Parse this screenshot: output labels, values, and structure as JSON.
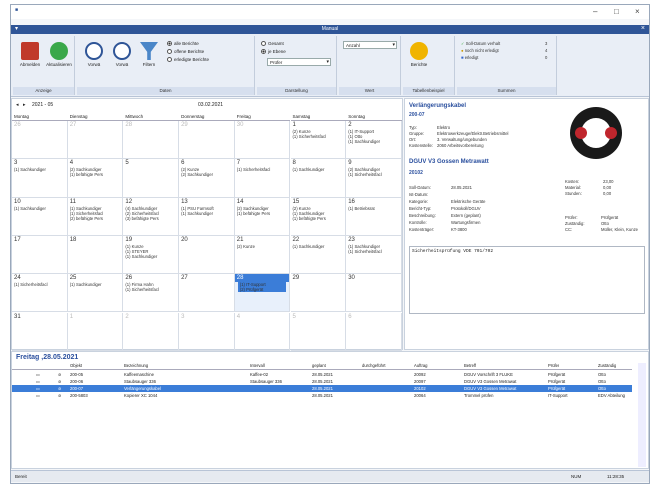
{
  "window": {
    "title": "Manual",
    "min": "–",
    "max": "□",
    "close": "×"
  },
  "ribbon": {
    "groups": [
      {
        "label": "Anzeige"
      },
      {
        "label": "Daten"
      },
      {
        "label": "Darstellung"
      },
      {
        "label": "Wert"
      },
      {
        "label": "Tabellenbeispiel"
      },
      {
        "label": "Summen"
      }
    ],
    "buttons": {
      "abmelden": "Abmelden",
      "aktualisieren": "Aktualisieren",
      "vorwaerts": "Vorwä",
      "rueckwaerts": "Vorwä",
      "filtern": "Filtern",
      "berichte": "Berichte"
    },
    "radios_daten": [
      "alle Berichte",
      "offene Berichte",
      "erledigte Berichte"
    ],
    "radios_darst": [
      "Gesamt",
      "je Ebene"
    ],
    "combo_pruefer": "Prüfer",
    "combo_wert": "Anzahl",
    "summen": [
      {
        "label": "Soll-Datum verhalt",
        "value": "3"
      },
      {
        "label": "noch nicht erledigt",
        "value": "4"
      },
      {
        "label": "erledigt",
        "value": "0"
      }
    ]
  },
  "calendar": {
    "month": "2021 - 05",
    "date_center": "03.02.2021",
    "weekdays": [
      "Montag",
      "Dienstag",
      "Mittwoch",
      "Donnerstag",
      "Freitag",
      "Samstag",
      "Sonntag"
    ],
    "weeks": [
      [
        {
          "d": "26",
          "dim": true,
          "ev": []
        },
        {
          "d": "27",
          "dim": true,
          "ev": []
        },
        {
          "d": "28",
          "dim": true,
          "ev": []
        },
        {
          "d": "29",
          "dim": true,
          "ev": []
        },
        {
          "d": "30",
          "dim": true,
          "ev": []
        },
        {
          "d": "1",
          "ev": [
            "(2) Kunze",
            "(1) Sicherheitsfacl"
          ]
        },
        {
          "d": "2",
          "ev": [
            "(1) IT-Support",
            "(1) Otto",
            "(1) Sachkundiger"
          ]
        }
      ],
      [
        {
          "d": "3",
          "ev": [
            "(1) Sachkundiger"
          ]
        },
        {
          "d": "4",
          "ev": [
            "(2) Sachkundiger",
            "(1) befähigte Pers"
          ]
        },
        {
          "d": "5",
          "ev": []
        },
        {
          "d": "6",
          "ev": [
            "(2) Kunze",
            "(2) Sachkundiger"
          ]
        },
        {
          "d": "7",
          "ev": [
            "(1) Sicherheitsfacl"
          ]
        },
        {
          "d": "8",
          "ev": [
            "(1) Sachkundiger"
          ]
        },
        {
          "d": "9",
          "ev": [
            "(2) Sachkundiger",
            "(1) Sicherheitsfacl"
          ]
        }
      ],
      [
        {
          "d": "10",
          "ev": [
            "(1) Sachkundiger"
          ]
        },
        {
          "d": "11",
          "ev": [
            "(1) Sachkundiger",
            "(1) Sicherheitsfacl",
            "(2) befähigte Pers"
          ]
        },
        {
          "d": "12",
          "ev": [
            "(4) Sachkundiger",
            "(2) Sicherheitsfacl",
            "(3) befähigte Pers"
          ]
        },
        {
          "d": "13",
          "ev": [
            "(1) PSU Farmsoft",
            "(1) Sachkundiger"
          ]
        },
        {
          "d": "14",
          "ev": [
            "(2) Sachkundiger",
            "(1) befähigte Pers"
          ]
        },
        {
          "d": "15",
          "ev": [
            "(2) Kunze",
            "(1) Sachkundiger",
            "(1) befähigte Pers"
          ]
        },
        {
          "d": "16",
          "ev": [
            "(1) Betriebsrat"
          ]
        }
      ],
      [
        {
          "d": "17",
          "ev": []
        },
        {
          "d": "18",
          "ev": []
        },
        {
          "d": "19",
          "ev": [
            "(1) Kunze",
            "(1) STEYER",
            "(1) Sachkundiger"
          ]
        },
        {
          "d": "20",
          "ev": []
        },
        {
          "d": "21",
          "ev": [
            "(2) Kunze"
          ]
        },
        {
          "d": "22",
          "ev": [
            "(1) Sachkundiger"
          ]
        },
        {
          "d": "23",
          "ev": [
            "(1) Sachkundiger",
            "(1) Sicherheitsfacl"
          ]
        }
      ],
      [
        {
          "d": "24",
          "ev": [
            "(1) Sicherheitsfacl"
          ]
        },
        {
          "d": "25",
          "ev": [
            "(1) Sachkundiger"
          ]
        },
        {
          "d": "26",
          "ev": [
            "(1) Firma Hahn",
            "(1) Sicherheitsfacl"
          ]
        },
        {
          "d": "27",
          "ev": []
        },
        {
          "d": "28",
          "sel": true,
          "ev": [
            "(1) IT-Support",
            "(2) Prüfgerät"
          ]
        },
        {
          "d": "29",
          "ev": []
        },
        {
          "d": "30",
          "ev": []
        }
      ],
      [
        {
          "d": "31",
          "ev": []
        },
        {
          "d": "1",
          "dim": true,
          "ev": []
        },
        {
          "d": "2",
          "dim": true,
          "ev": []
        },
        {
          "d": "3",
          "dim": true,
          "ev": []
        },
        {
          "d": "4",
          "dim": true,
          "ev": []
        },
        {
          "d": "5",
          "dim": true,
          "ev": []
        },
        {
          "d": "6",
          "dim": true,
          "ev": []
        }
      ]
    ]
  },
  "detail": {
    "title": "Verlängerungskabel",
    "id": "200-07",
    "info": [
      [
        "Typ:",
        "Elektro"
      ],
      [
        "Gruppe:",
        "Elektrowerkzeuge/Elektr.Betriebsmittel"
      ],
      [
        "Ort:",
        "3. Verwaltung/ungebunden"
      ],
      [
        "Kostenstelle:",
        "2060 Arbeitsvorbereitung"
      ]
    ],
    "pruef": "DGUV V3 Gossen Metrawatt",
    "pruef_id": "20102",
    "fields": [
      [
        "Soll-Datum:",
        "28.05.2021"
      ],
      [
        "Ist-Datum:",
        ""
      ],
      [
        "Kategorie:",
        "Elektrische Geräte"
      ],
      [
        "Bericht-Typ:",
        "Protokoll/DGUV"
      ],
      [
        "Beschreibung:",
        "Extern (geplant)"
      ],
      [
        "Kontrolle:",
        "Wartungsfirmen"
      ],
      [
        "Kostenträger:",
        "KT-3800"
      ]
    ],
    "costs": [
      [
        "Kosten:",
        "23,00"
      ],
      [
        "Material:",
        "0,00"
      ],
      [
        "Stunden:",
        "0,00"
      ]
    ],
    "roles": [
      [
        "Prüfer:",
        "Prüfgerät"
      ],
      [
        "Zuständig:",
        "Otto"
      ],
      [
        "CC:",
        "Müller, Klein, Kunze"
      ]
    ],
    "note": "Sicherheitsprüfung VDE 701/702"
  },
  "list": {
    "title": "Freitag ,28.05.2021",
    "cols": [
      "Objekt",
      "Bezeichnung",
      "Intervall",
      "geplant",
      "durchgeführt",
      "Auftrag",
      "Betreff",
      "Prüfer",
      "Zuständig"
    ],
    "rows": [
      [
        "200-05",
        "Kaffeemaschine",
        "Kaffee-02",
        "28.05.2021",
        "",
        "20092",
        "DGUV Vorschrift 3 FLUKE",
        "Prüfgerät",
        "Otto"
      ],
      [
        "200-06",
        "Staubsauger 336",
        "Staubsauger 336",
        "28.05.2021",
        "",
        "20097",
        "DGUV V3 Gossen Metrawat",
        "Prüfgerät",
        "Otto"
      ],
      [
        "200-07",
        "Verlängerungskabel",
        "",
        "28.05.2021",
        "",
        "20102",
        "DGUV V3 Gossen Metrawat",
        "Prüfgerät",
        "Otto"
      ],
      [
        "200-5803",
        "Kopierer XC 1044",
        "",
        "28.05.2021",
        "",
        "20064",
        "Trommel prüfen",
        "IT-Support",
        "EDV Abteilung"
      ]
    ]
  },
  "status": {
    "left": "Bereit",
    "num": "NUM",
    "time": "11:28:35"
  }
}
